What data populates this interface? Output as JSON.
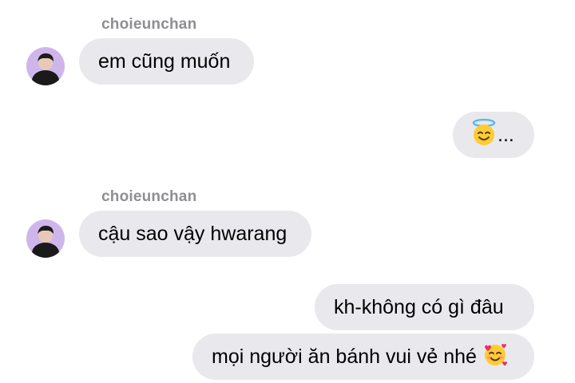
{
  "conversation": {
    "messages": [
      {
        "sender": "choieunchan",
        "text": "em cũng muốn",
        "direction": "incoming"
      },
      {
        "text": "...",
        "emoji": "smiling-face-with-halo",
        "direction": "outgoing"
      },
      {
        "sender": "choieunchan",
        "text": "cậu sao vậy hwarang",
        "direction": "incoming"
      },
      {
        "text": "kh-không có gì đâu",
        "direction": "outgoing"
      },
      {
        "text": "mọi người ăn bánh vui vẻ nhé",
        "emoji": "smiling-face-with-hearts",
        "direction": "outgoing"
      }
    ]
  },
  "colors": {
    "bubble": "#e9e9ed",
    "sender_name": "#8e8e93",
    "avatar_bg": "#cfb6ea"
  }
}
